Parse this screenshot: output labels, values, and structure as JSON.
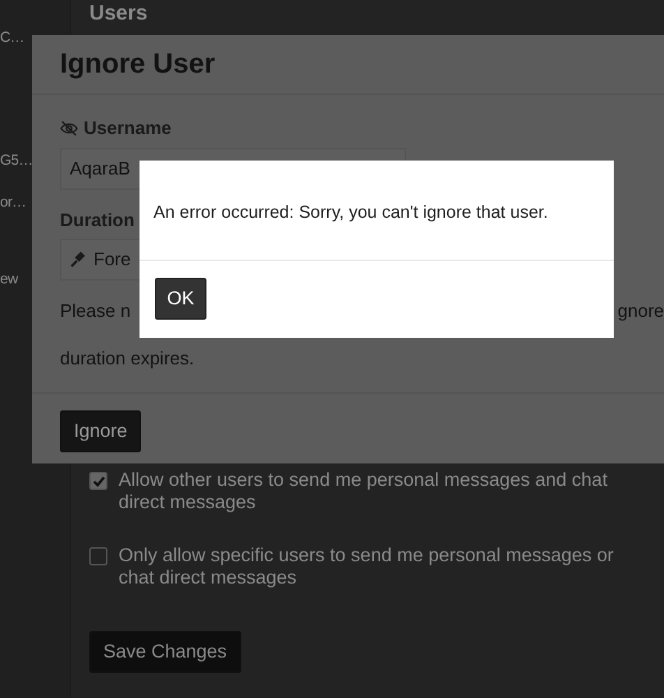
{
  "page": {
    "heading": "Users",
    "sidebar": {
      "items": [
        {
          "label": "C…"
        },
        {
          "label": "G5…"
        },
        {
          "label": "or…"
        },
        {
          "label": "ew"
        }
      ]
    },
    "options": [
      {
        "label": "Allow other users to send me personal messages and chat direct messages",
        "checked": true
      },
      {
        "label": "Only allow specific users to send me personal messages or chat direct messages",
        "checked": false
      }
    ],
    "save_button": "Save Changes"
  },
  "modal": {
    "title": "Ignore User",
    "username_label": "Username",
    "username_value": "AqaraB",
    "duration_label": "Duration",
    "duration_value": "Fore",
    "note": {
      "line_1_start": "Please n",
      "line_1_end": "gnore",
      "line_2": "duration expires."
    },
    "button": "Ignore"
  },
  "alert": {
    "message": "An error occurred: Sorry, you can't ignore that user.",
    "button": "OK"
  }
}
